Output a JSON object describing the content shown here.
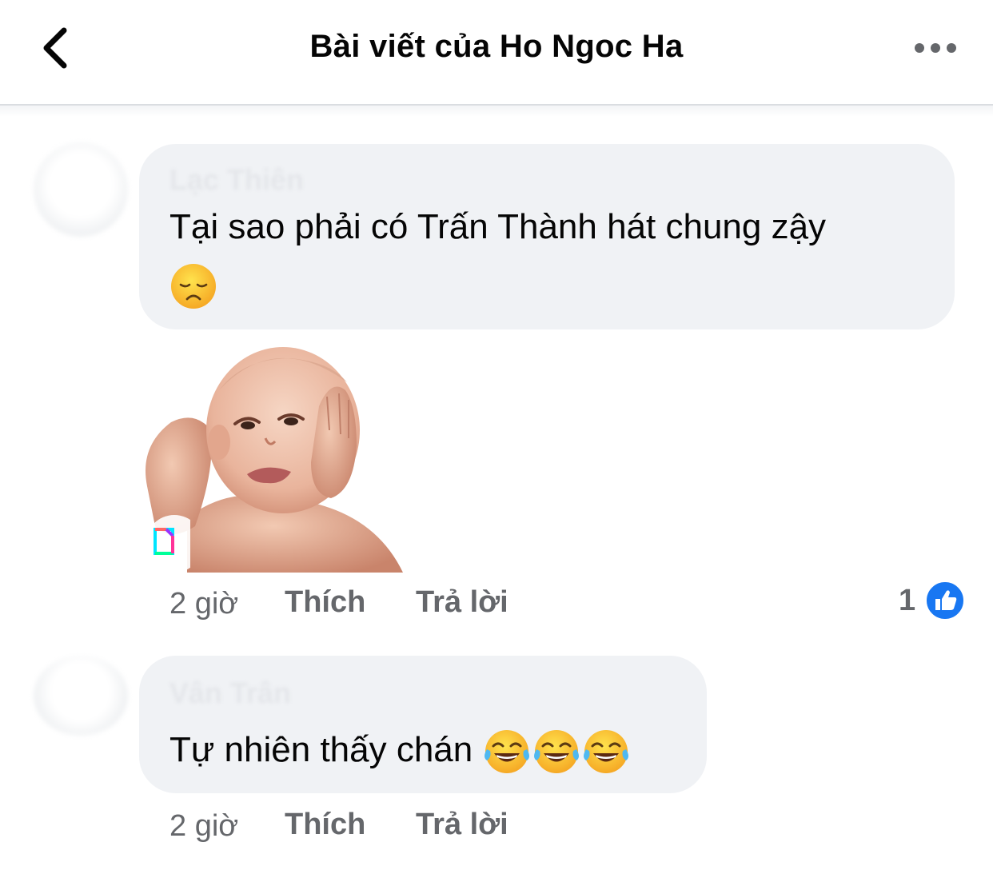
{
  "header": {
    "title": "Bài viết của Ho Ngoc Ha",
    "back_icon": "chevron-left-icon",
    "more_icon": "more-horizontal-icon"
  },
  "comments": [
    {
      "author": "Lạc Thiên",
      "text": "Tại sao phải có Trấn Thành hát chung zậy",
      "emojis": [
        "disappointed-face-emoji"
      ],
      "attachment": "crying-baby-sticker",
      "time": "2 giờ",
      "like_label": "Thích",
      "reply_label": "Trả lời",
      "reaction_count": "1",
      "reaction_icon": "like-reaction-icon"
    },
    {
      "author": "Vân Trân",
      "text": "Tự nhiên thấy chán",
      "emojis": [
        "tears-of-joy-emoji",
        "tears-of-joy-emoji",
        "tears-of-joy-emoji"
      ],
      "time": "2 giờ",
      "like_label": "Thích",
      "reply_label": "Trả lời"
    }
  ],
  "colors": {
    "bubble": "#f0f2f5",
    "meta_text": "#65676b",
    "like_blue": "#1877f2",
    "divider": "#dadde1"
  }
}
